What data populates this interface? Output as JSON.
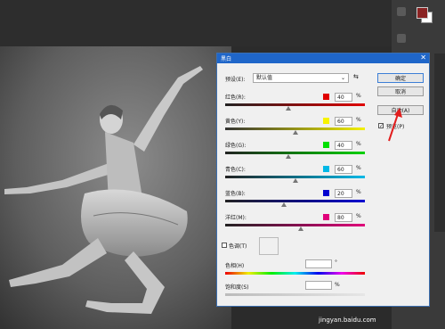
{
  "dialog": {
    "title": "黑白",
    "close_glyph": "✕",
    "preset_label": "预设(E):",
    "preset_value": "默认值",
    "ok_label": "确定",
    "cancel_label": "取消",
    "auto_label": "自动(A)",
    "preview_label": "预览(P)",
    "preview_checked": true,
    "sliders": [
      {
        "label": "红色(R):",
        "value": "40",
        "unit": "%",
        "swatch": "#e00000",
        "level": 0.45
      },
      {
        "label": "黄色(Y):",
        "value": "60",
        "unit": "%",
        "swatch": "#f7f300",
        "level": 0.5
      },
      {
        "label": "绿色(G):",
        "value": "40",
        "unit": "%",
        "swatch": "#00e000",
        "level": 0.45
      },
      {
        "label": "青色(C):",
        "value": "60",
        "unit": "%",
        "swatch": "#00b8e6",
        "level": 0.5
      },
      {
        "label": "蓝色(B):",
        "value": "20",
        "unit": "%",
        "swatch": "#0000d0",
        "level": 0.42
      },
      {
        "label": "洋红(M):",
        "value": "80",
        "unit": "%",
        "swatch": "#e0007a",
        "level": 0.54
      }
    ],
    "tint_label": "色调(T)",
    "hue_label": "色相(H)",
    "hue_unit": "°",
    "saturation_label": "饱和度(S)",
    "saturation_unit": "%"
  },
  "workspace": {
    "fg_color": "#8a2323",
    "bg_color": "#ffffff"
  },
  "watermark": "jingyan.baidu.com"
}
